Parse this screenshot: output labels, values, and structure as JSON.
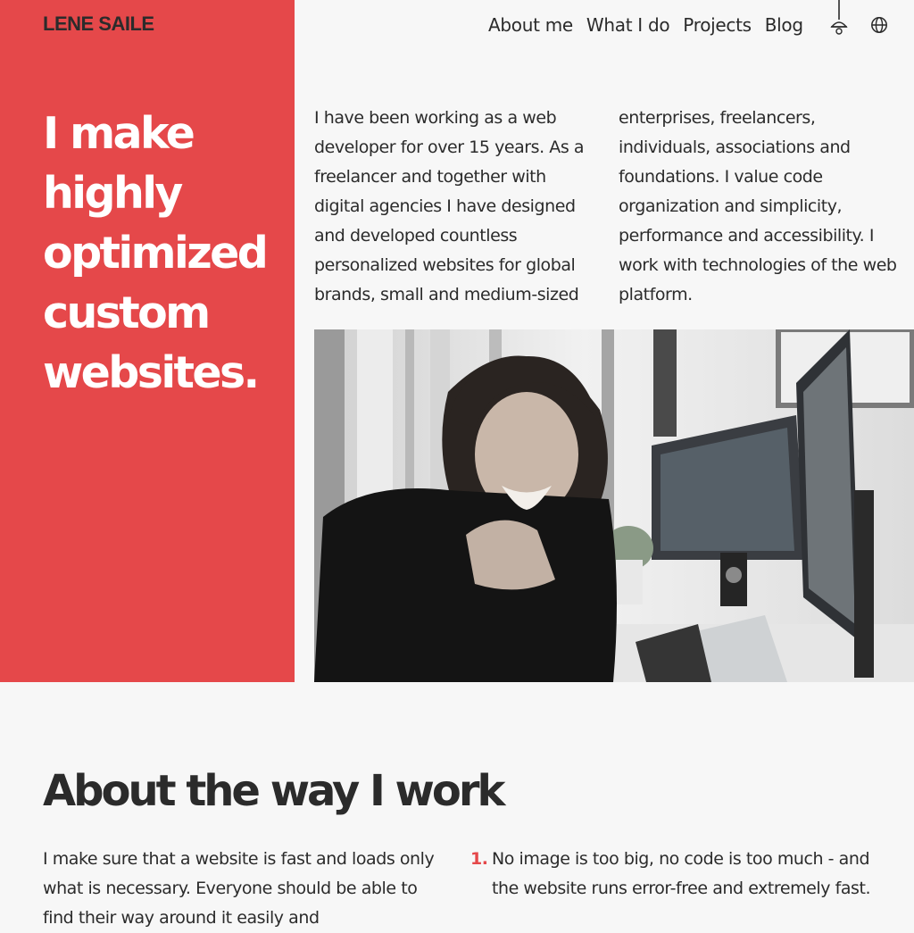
{
  "brand": {
    "logo": "LENE SAILE",
    "accent": "#e5484a"
  },
  "nav": {
    "items": [
      "About me",
      "What I do",
      "Projects",
      "Blog"
    ],
    "icons": [
      "lamp-icon",
      "globe-icon"
    ]
  },
  "hero": {
    "headline": "I make highly optimized custom websites.",
    "intro": "I have been working as a web developer for over 15 years. As a freelancer and together with digital agencies I have designed and developed countless personalized websites for global brands, small and medium-sized enterprises, freelancers, individuals, associations and foundations. I value code organization and simplicity, performance and accessibility. I work with technologies of the web platform."
  },
  "work": {
    "title": "About the way I work",
    "text": "I make sure that a website is fast and loads only what is necessary. Everyone should be able to find their way around it easily and",
    "list": [
      {
        "num": "1.",
        "text": "No image is too big, no code is too much - and the website runs error-free and extremely fast."
      }
    ]
  }
}
